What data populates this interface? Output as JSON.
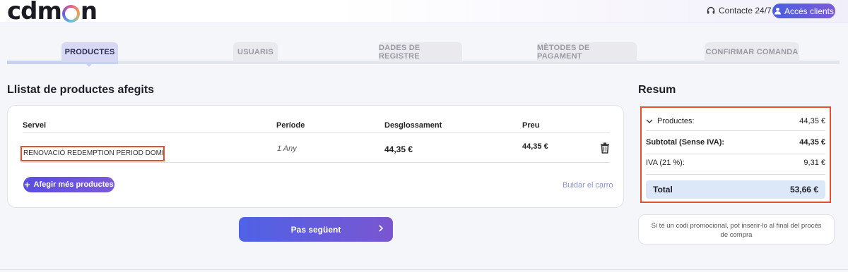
{
  "header": {
    "logo": "cdmon",
    "contact_label": "Contacte 24/7",
    "access_label": "Accés clients"
  },
  "steps": [
    {
      "label": "PRODUCTES",
      "active": true
    },
    {
      "label": "USUARIS",
      "active": false
    },
    {
      "label": "DADES DE REGISTRE",
      "active": false
    },
    {
      "label": "MÈTODES DE PAGAMENT",
      "active": false
    },
    {
      "label": "CONFIRMAR COMANDA",
      "active": false
    }
  ],
  "products": {
    "title": "Llistat de productes afegits",
    "columns": [
      "Servei",
      "Període",
      "Desglossament",
      "Preu"
    ],
    "rows": [
      {
        "service": "RENOVACIÓ REDEMPTION PERIOD DOMINI .EU",
        "period": "1 Any",
        "breakdown": "44,35 €",
        "price": "44,35 €"
      }
    ],
    "add_button": "Afegir més productes",
    "clear_link": "Buidar el carro"
  },
  "next_button": "Pas següent",
  "summary": {
    "title": "Resum",
    "products_label": "Productes:",
    "products_value": "44,35 €",
    "subtotal_label": "Subtotal (Sense IVA):",
    "subtotal_value": "44,35 €",
    "iva_label": "IVA (21 %):",
    "iva_value": "9,31 €",
    "total_label": "Total",
    "total_value": "53,66 €",
    "promo_text": "Si té un codi promocional, pot inserir-lo al final del procés de compra"
  },
  "colors": {
    "accent": "#5a4ee0",
    "highlight_border": "#e2502c",
    "total_bg": "#dce7f8"
  }
}
